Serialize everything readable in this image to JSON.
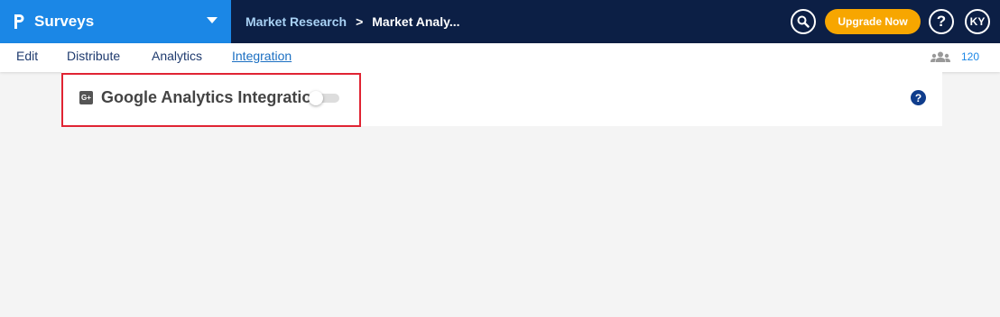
{
  "app": {
    "name": "Surveys",
    "logo_icon": "questionpro-logo-icon",
    "switcher_icon": "chevron-down-icon"
  },
  "breadcrumb": {
    "parent": "Market Research",
    "separator": ">",
    "current": "Market Analy..."
  },
  "header": {
    "search_icon": "search-icon",
    "upgrade_label": "Upgrade Now",
    "help_label": "?",
    "avatar_initials": "KY"
  },
  "tabs": [
    {
      "label": "Edit",
      "active": false
    },
    {
      "label": "Distribute",
      "active": false
    },
    {
      "label": "Analytics",
      "active": false
    },
    {
      "label": "Integration",
      "active": true
    }
  ],
  "responses": {
    "icon": "users-icon",
    "count": "120"
  },
  "integration": {
    "icon_label": "G+",
    "title": "Google Analytics Integration",
    "enabled": false,
    "help_label": "?"
  },
  "colors": {
    "header_bg": "#0c1f45",
    "app_bg": "#1b87e6",
    "upgrade_bg": "#f7a600",
    "highlight": "#e02433"
  }
}
